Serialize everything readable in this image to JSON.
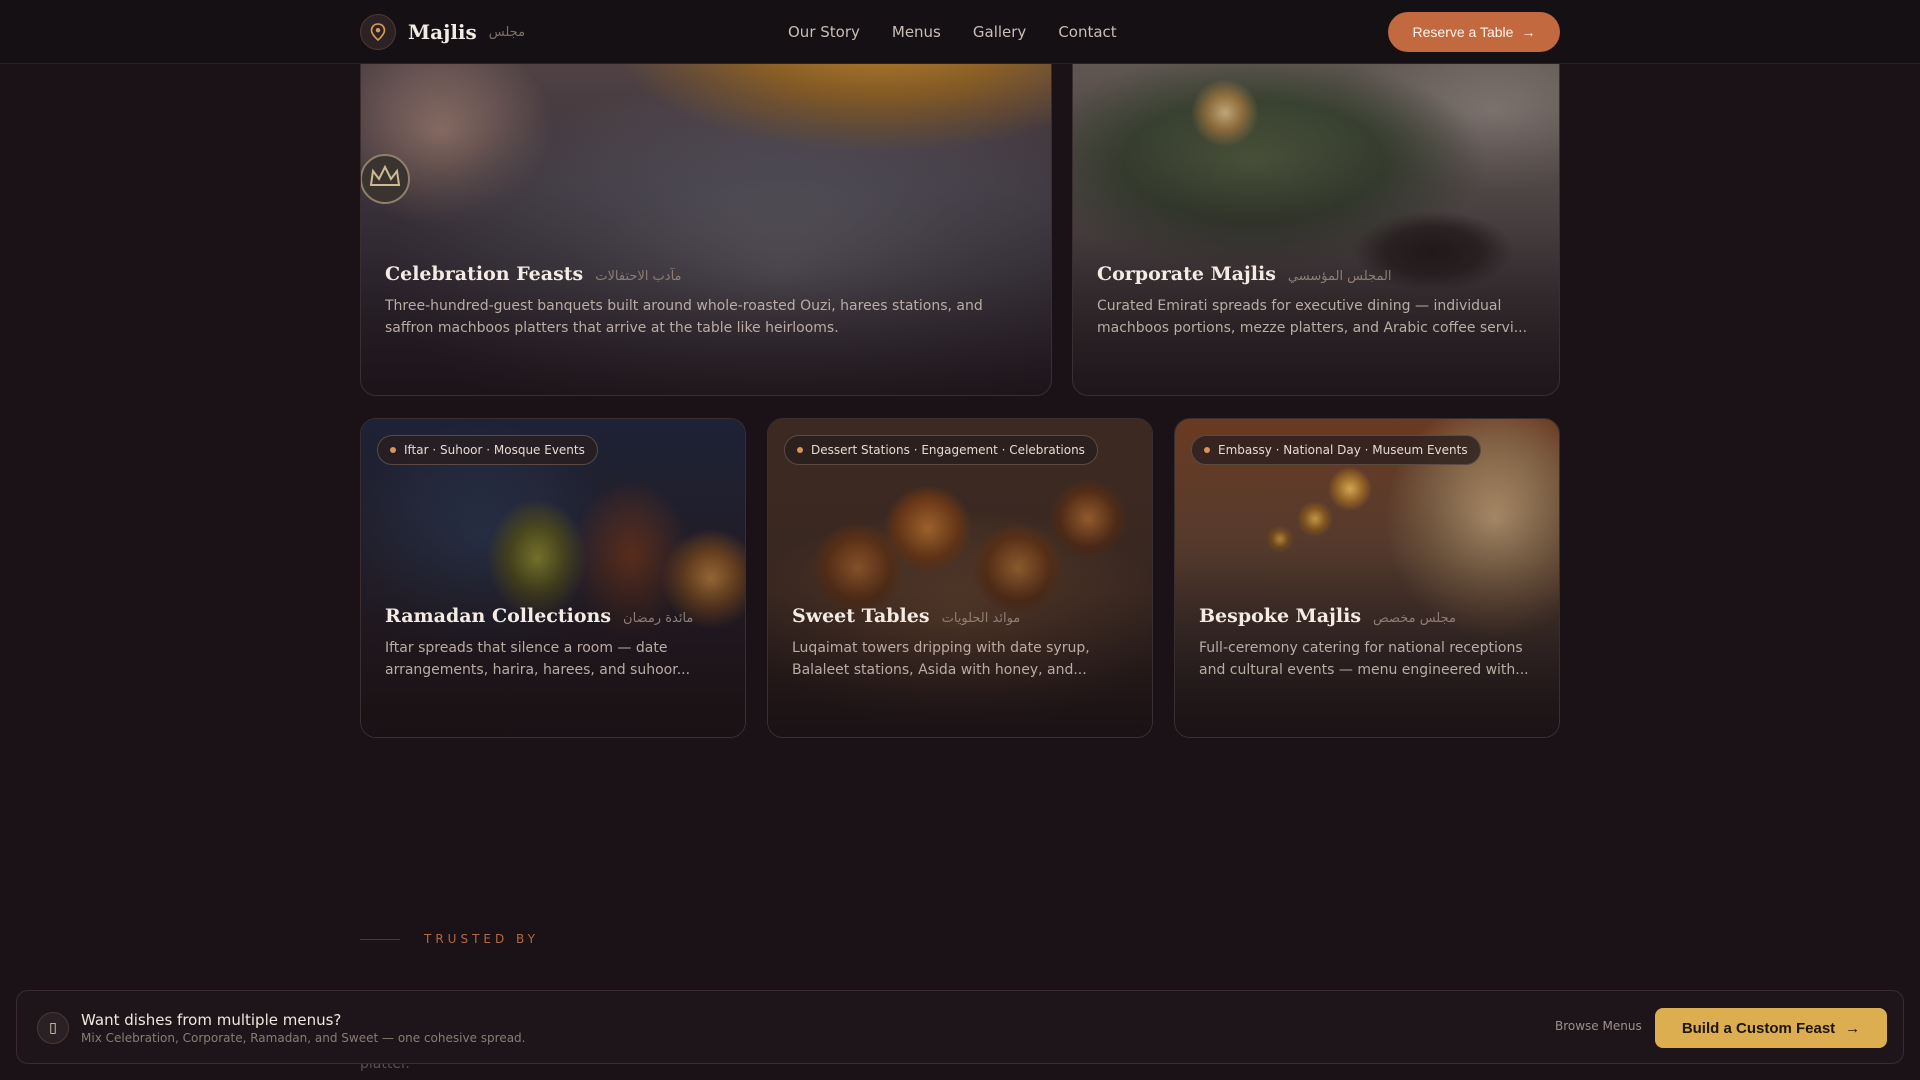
{
  "header": {
    "brand_name": "Majlis",
    "brand_arabic": "مجلس",
    "nav": [
      "Our Story",
      "Menus",
      "Gallery",
      "Contact"
    ],
    "reserve_label": "Reserve a Table",
    "reserve_arrow": "→"
  },
  "cards": [
    {
      "title": "Celebration Feasts",
      "arabic": "مآدب الاحتفالات",
      "desc": "Three-hundred-guest banquets built around whole-roasted Ouzi, harees stations, and saffron machboos platters that arrive at the table like heirlooms."
    },
    {
      "title": "Corporate Majlis",
      "arabic": "المجلس المؤسسي",
      "desc": "Curated Emirati spreads for executive dining — individual machboos portions, mezze platters, and Arabic coffee servi..."
    },
    {
      "chip": "Iftar · Suhoor · Mosque Events",
      "title": "Ramadan Collections",
      "arabic": "مائدة رمضان",
      "desc": "Iftar spreads that silence a room — date arrangements, harira, harees, and suhoor..."
    },
    {
      "chip": "Dessert Stations · Engagement · Celebrations",
      "title": "Sweet Tables",
      "arabic": "موائد الحلويات",
      "desc": "Luqaimat towers dripping with date syrup, Balaleet stations, Asida with honey, and..."
    },
    {
      "chip": "Embassy · National Day · Museum Events",
      "title": "Bespoke Majlis",
      "arabic": "مجلس مخصص",
      "desc": "Full-ceremony catering for national receptions and cultural events — menu engineered with..."
    }
  ],
  "trusted": {
    "label": "TRUSTED BY"
  },
  "stray_text": "platter.",
  "banner": {
    "icon_glyph": "▯",
    "title": "Want dishes from multiple menus?",
    "subtitle": "Mix Celebration, Corporate, Ramadan, and Sweet — one cohesive spread.",
    "browse_label": "Browse Menus",
    "build_label": "Build a Custom Feast",
    "build_arrow": "→"
  },
  "colors": {
    "accent": "#c2693f",
    "gold": "#ddae4f",
    "background": "#1a1217"
  },
  "icons": {
    "brand": "map-pin-icon",
    "arrow": "arrow-right-icon",
    "banner": "feast-icon"
  }
}
